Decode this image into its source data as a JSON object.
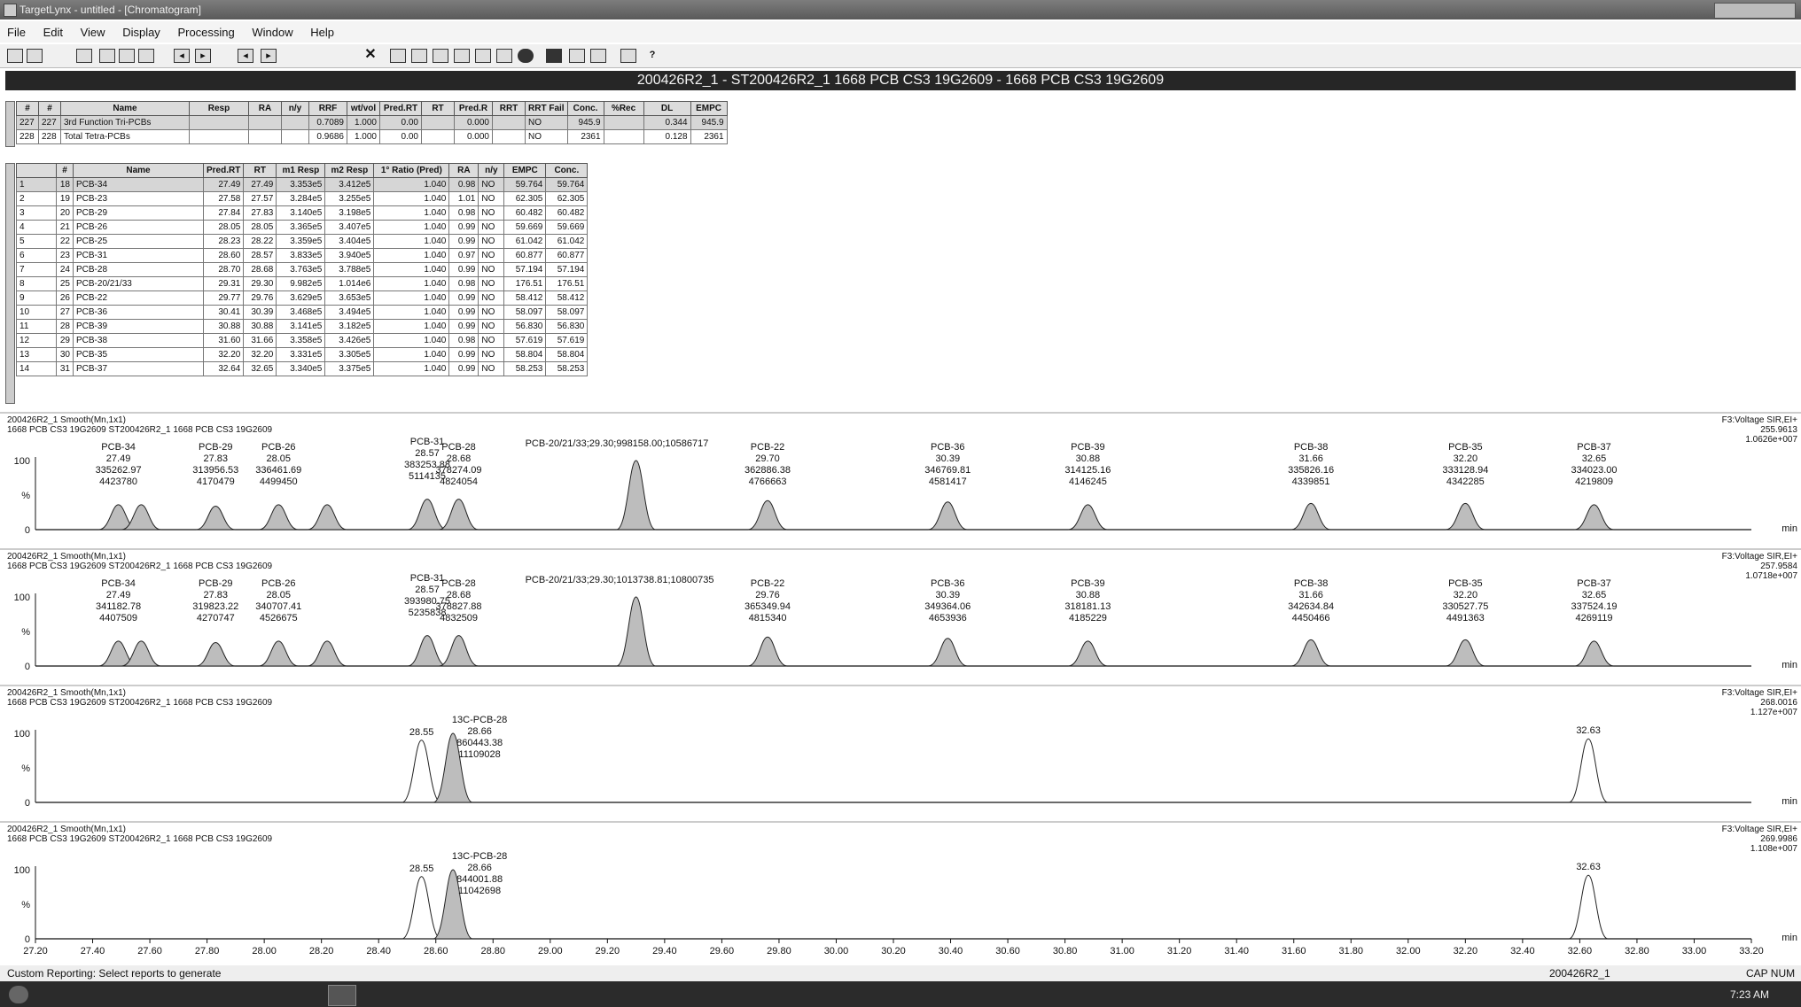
{
  "app": {
    "title": "TargetLynx - untitled - [Chromatogram]"
  },
  "menu": [
    "File",
    "Edit",
    "View",
    "Display",
    "Processing",
    "Window",
    "Help"
  ],
  "header": {
    "title": "200426R2_1 - ST200426R2_1 1668 PCB CS3 19G2609 - 1668 PCB CS3 19G2609"
  },
  "summary_table": {
    "columns": [
      "#",
      "#",
      "Name",
      "Resp",
      "RA",
      "n/y",
      "RRF",
      "wt/vol",
      "Pred.RT",
      "RT",
      "Pred.R",
      "RRT",
      "RRT Fail",
      "Conc.",
      "%Rec",
      "DL",
      "EMPC"
    ],
    "rows": [
      [
        "227",
        "227",
        "3rd Function Tri-PCBs",
        "",
        "",
        "",
        "0.7089",
        "1.000",
        "0.00",
        "",
        "0.000",
        "",
        "NO",
        "945.9",
        "",
        "0.344",
        "945.9"
      ],
      [
        "228",
        "228",
        "Total Tetra-PCBs",
        "",
        "",
        "",
        "0.9686",
        "1.000",
        "0.00",
        "",
        "0.000",
        "",
        "NO",
        "2361",
        "",
        "0.128",
        "2361"
      ]
    ]
  },
  "compound_table": {
    "columns": [
      "",
      "#",
      "Name",
      "Pred.RT",
      "RT",
      "m1 Resp",
      "m2 Resp",
      "1° Ratio (Pred)",
      "RA",
      "n/y",
      "EMPC",
      "Conc."
    ],
    "rows": [
      [
        "1",
        "18",
        "PCB-34",
        "27.49",
        "27.49",
        "3.353e5",
        "3.412e5",
        "1.040",
        "0.98",
        "NO",
        "59.764",
        "59.764"
      ],
      [
        "2",
        "19",
        "PCB-23",
        "27.58",
        "27.57",
        "3.284e5",
        "3.255e5",
        "1.040",
        "1.01",
        "NO",
        "62.305",
        "62.305"
      ],
      [
        "3",
        "20",
        "PCB-29",
        "27.84",
        "27.83",
        "3.140e5",
        "3.198e5",
        "1.040",
        "0.98",
        "NO",
        "60.482",
        "60.482"
      ],
      [
        "4",
        "21",
        "PCB-26",
        "28.05",
        "28.05",
        "3.365e5",
        "3.407e5",
        "1.040",
        "0.99",
        "NO",
        "59.669",
        "59.669"
      ],
      [
        "5",
        "22",
        "PCB-25",
        "28.23",
        "28.22",
        "3.359e5",
        "3.404e5",
        "1.040",
        "0.99",
        "NO",
        "61.042",
        "61.042"
      ],
      [
        "6",
        "23",
        "PCB-31",
        "28.60",
        "28.57",
        "3.833e5",
        "3.940e5",
        "1.040",
        "0.97",
        "NO",
        "60.877",
        "60.877"
      ],
      [
        "7",
        "24",
        "PCB-28",
        "28.70",
        "28.68",
        "3.763e5",
        "3.788e5",
        "1.040",
        "0.99",
        "NO",
        "57.194",
        "57.194"
      ],
      [
        "8",
        "25",
        "PCB-20/21/33",
        "29.31",
        "29.30",
        "9.982e5",
        "1.014e6",
        "1.040",
        "0.98",
        "NO",
        "176.51",
        "176.51"
      ],
      [
        "9",
        "26",
        "PCB-22",
        "29.77",
        "29.76",
        "3.629e5",
        "3.653e5",
        "1.040",
        "0.99",
        "NO",
        "58.412",
        "58.412"
      ],
      [
        "10",
        "27",
        "PCB-36",
        "30.41",
        "30.39",
        "3.468e5",
        "3.494e5",
        "1.040",
        "0.99",
        "NO",
        "58.097",
        "58.097"
      ],
      [
        "11",
        "28",
        "PCB-39",
        "30.88",
        "30.88",
        "3.141e5",
        "3.182e5",
        "1.040",
        "0.99",
        "NO",
        "56.830",
        "56.830"
      ],
      [
        "12",
        "29",
        "PCB-38",
        "31.60",
        "31.66",
        "3.358e5",
        "3.426e5",
        "1.040",
        "0.98",
        "NO",
        "57.619",
        "57.619"
      ],
      [
        "13",
        "30",
        "PCB-35",
        "32.20",
        "32.20",
        "3.331e5",
        "3.305e5",
        "1.040",
        "0.99",
        "NO",
        "58.804",
        "58.804"
      ],
      [
        "14",
        "31",
        "PCB-37",
        "32.64",
        "32.65",
        "3.340e5",
        "3.375e5",
        "1.040",
        "0.99",
        "NO",
        "58.253",
        "58.253"
      ]
    ]
  },
  "chromatograms": {
    "xaxis": {
      "min": 27.2,
      "max": 33.2,
      "label": "min",
      "ticks": [
        "27.20",
        "27.40",
        "27.60",
        "27.80",
        "28.00",
        "28.20",
        "28.40",
        "28.60",
        "28.80",
        "29.00",
        "29.20",
        "29.40",
        "29.60",
        "29.80",
        "30.00",
        "30.20",
        "30.40",
        "30.60",
        "30.80",
        "31.00",
        "31.20",
        "31.40",
        "31.60",
        "31.80",
        "32.00",
        "32.20",
        "32.40",
        "32.60",
        "32.80",
        "33.00",
        "33.20"
      ]
    },
    "y_ticks": [
      "100",
      "%",
      "0"
    ],
    "panels": [
      {
        "title": "200426R2_1 Smooth(Mn,1x1)",
        "subtitle": "1668 PCB CS3 19G2609 ST200426R2_1 1668 PCB CS3 19G2609",
        "right_lines": [
          "F3:Voltage SIR,EI+",
          "255.9613",
          "1.0626e+007"
        ],
        "peaks": [
          {
            "rt": 27.49,
            "h": 0.36,
            "filled": true
          },
          {
            "rt": 27.57,
            "h": 0.36,
            "filled": true
          },
          {
            "rt": 27.83,
            "h": 0.34,
            "filled": true
          },
          {
            "rt": 28.05,
            "h": 0.36,
            "filled": true
          },
          {
            "rt": 28.22,
            "h": 0.36,
            "filled": true
          },
          {
            "rt": 28.57,
            "h": 0.44,
            "filled": true
          },
          {
            "rt": 28.68,
            "h": 0.44,
            "filled": true
          },
          {
            "rt": 29.3,
            "h": 1.0,
            "filled": true
          },
          {
            "rt": 29.76,
            "h": 0.42,
            "filled": true
          },
          {
            "rt": 30.39,
            "h": 0.4,
            "filled": true
          },
          {
            "rt": 30.88,
            "h": 0.36,
            "filled": true
          },
          {
            "rt": 31.66,
            "h": 0.38,
            "filled": true
          },
          {
            "rt": 32.2,
            "h": 0.38,
            "filled": true
          },
          {
            "rt": 32.65,
            "h": 0.36,
            "filled": true
          }
        ],
        "labels": [
          {
            "rt": 27.49,
            "lines": [
              "PCB-34",
              "27.49",
              "335262.97",
              "4423780"
            ]
          },
          {
            "rt": 27.83,
            "lines": [
              "PCB-29",
              "27.83",
              "313956.53",
              "4170479"
            ]
          },
          {
            "rt": 28.05,
            "lines": [
              "PCB-26",
              "28.05",
              "336461.69",
              "4499450"
            ]
          },
          {
            "rt": 28.57,
            "lines": [
              "PCB-31",
              "28.57",
              "383253.88",
              "5114135"
            ],
            "low": true
          },
          {
            "rt": 28.68,
            "lines": [
              "PCB-28",
              "28.68",
              "378274.09",
              "4824054"
            ]
          },
          {
            "rt": 29.3,
            "lines": [
              "PCB-20/21/33;29.30;998158.00;10586717"
            ],
            "inline": true
          },
          {
            "rt": 29.76,
            "lines": [
              "PCB-22",
              "29.70",
              "362886.38",
              "4766663"
            ]
          },
          {
            "rt": 30.39,
            "lines": [
              "PCB-36",
              "30.39",
              "346769.81",
              "4581417"
            ]
          },
          {
            "rt": 30.88,
            "lines": [
              "PCB-39",
              "30.88",
              "314125.16",
              "4146245"
            ]
          },
          {
            "rt": 31.66,
            "lines": [
              "PCB-38",
              "31.66",
              "335826.16",
              "4339851"
            ]
          },
          {
            "rt": 32.2,
            "lines": [
              "PCB-35",
              "32.20",
              "333128.94",
              "4342285"
            ]
          },
          {
            "rt": 32.65,
            "lines": [
              "PCB-37",
              "32.65",
              "334023.00",
              "4219809"
            ]
          }
        ]
      },
      {
        "title": "200426R2_1 Smooth(Mn,1x1)",
        "subtitle": "1668 PCB CS3 19G2609 ST200426R2_1 1668 PCB CS3 19G2609",
        "right_lines": [
          "F3:Voltage SIR,EI+",
          "257.9584",
          "1.0718e+007"
        ],
        "peaks": [
          {
            "rt": 27.49,
            "h": 0.36,
            "filled": true
          },
          {
            "rt": 27.57,
            "h": 0.36,
            "filled": true
          },
          {
            "rt": 27.83,
            "h": 0.34,
            "filled": true
          },
          {
            "rt": 28.05,
            "h": 0.36,
            "filled": true
          },
          {
            "rt": 28.22,
            "h": 0.36,
            "filled": true
          },
          {
            "rt": 28.57,
            "h": 0.44,
            "filled": true
          },
          {
            "rt": 28.68,
            "h": 0.44,
            "filled": true
          },
          {
            "rt": 29.3,
            "h": 1.0,
            "filled": true
          },
          {
            "rt": 29.76,
            "h": 0.42,
            "filled": true
          },
          {
            "rt": 30.39,
            "h": 0.4,
            "filled": true
          },
          {
            "rt": 30.88,
            "h": 0.36,
            "filled": true
          },
          {
            "rt": 31.66,
            "h": 0.38,
            "filled": true
          },
          {
            "rt": 32.2,
            "h": 0.38,
            "filled": true
          },
          {
            "rt": 32.65,
            "h": 0.36,
            "filled": true
          }
        ],
        "labels": [
          {
            "rt": 27.49,
            "lines": [
              "PCB-34",
              "27.49",
              "341182.78",
              "4407509"
            ]
          },
          {
            "rt": 27.83,
            "lines": [
              "PCB-29",
              "27.83",
              "319823.22",
              "4270747"
            ]
          },
          {
            "rt": 28.05,
            "lines": [
              "PCB-26",
              "28.05",
              "340707.41",
              "4526675"
            ]
          },
          {
            "rt": 28.57,
            "lines": [
              "PCB-31",
              "28.57",
              "393980.75",
              "5235838"
            ],
            "low": true
          },
          {
            "rt": 28.68,
            "lines": [
              "PCB-28",
              "28.68",
              "378827.88",
              "4832509"
            ]
          },
          {
            "rt": 29.3,
            "lines": [
              "PCB-20/21/33;29.30;1013738.81;10800735"
            ],
            "inline": true
          },
          {
            "rt": 29.76,
            "lines": [
              "PCB-22",
              "29.76",
              "365349.94",
              "4815340"
            ]
          },
          {
            "rt": 30.39,
            "lines": [
              "PCB-36",
              "30.39",
              "349364.06",
              "4653936"
            ]
          },
          {
            "rt": 30.88,
            "lines": [
              "PCB-39",
              "30.88",
              "318181.13",
              "4185229"
            ]
          },
          {
            "rt": 31.66,
            "lines": [
              "PCB-38",
              "31.66",
              "342634.84",
              "4450466"
            ]
          },
          {
            "rt": 32.2,
            "lines": [
              "PCB-35",
              "32.20",
              "330527.75",
              "4491363"
            ]
          },
          {
            "rt": 32.65,
            "lines": [
              "PCB-37",
              "32.65",
              "337524.19",
              "4269119"
            ]
          }
        ]
      },
      {
        "title": "200426R2_1 Smooth(Mn,1x1)",
        "subtitle": "1668 PCB CS3 19G2609 ST200426R2_1 1668 PCB CS3 19G2609",
        "right_lines": [
          "F3:Voltage SIR,EI+",
          "268.0016",
          "1.127e+007"
        ],
        "peaks": [
          {
            "rt": 28.55,
            "h": 0.9,
            "filled": false
          },
          {
            "rt": 28.66,
            "h": 1.0,
            "filled": true
          },
          {
            "rt": 32.63,
            "h": 0.92,
            "filled": false
          }
        ],
        "labels": [
          {
            "rt": 28.55,
            "lines": [
              "28.55"
            ],
            "simple": true
          },
          {
            "rt": 28.66,
            "lines": [
              "13C-PCB-28",
              "28.66",
              "860443.38",
              "11109028"
            ],
            "right": true
          },
          {
            "rt": 32.63,
            "lines": [
              "32.63"
            ],
            "simple": true
          }
        ]
      },
      {
        "title": "200426R2_1 Smooth(Mn,1x1)",
        "subtitle": "1668 PCB CS3 19G2609 ST200426R2_1 1668 PCB CS3 19G2609",
        "right_lines": [
          "F3:Voltage SIR,EI+",
          "269.9986",
          "1.108e+007"
        ],
        "peaks": [
          {
            "rt": 28.55,
            "h": 0.9,
            "filled": false
          },
          {
            "rt": 28.66,
            "h": 1.0,
            "filled": true
          },
          {
            "rt": 32.63,
            "h": 0.92,
            "filled": false
          }
        ],
        "labels": [
          {
            "rt": 28.55,
            "lines": [
              "28.55"
            ],
            "simple": true
          },
          {
            "rt": 28.66,
            "lines": [
              "13C-PCB-28",
              "28.66",
              "844001.88",
              "11042698"
            ],
            "right": true
          },
          {
            "rt": 32.63,
            "lines": [
              "32.63"
            ],
            "simple": true
          }
        ]
      }
    ]
  },
  "status": {
    "text": "Custom Reporting: Select reports to generate",
    "right": "200426R2_1",
    "caps": "CAP NUM"
  },
  "taskbar": {
    "time": "7:23 AM"
  }
}
